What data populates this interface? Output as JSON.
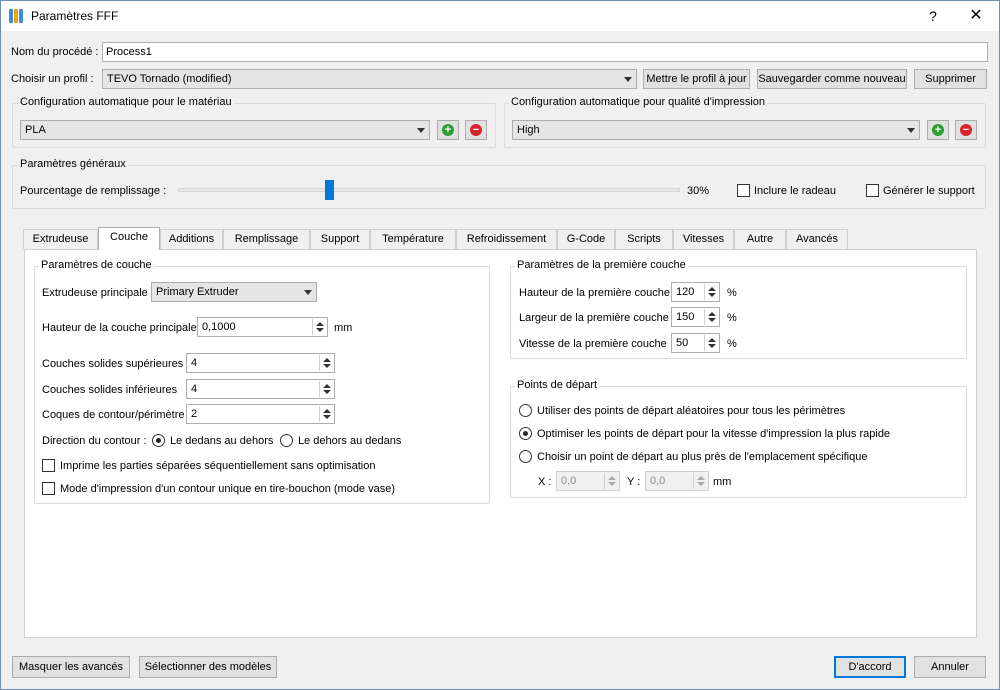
{
  "window": {
    "title": "Paramètres FFF",
    "help": "?",
    "close": "✕"
  },
  "process": {
    "label": "Nom du procédé :",
    "value": "Process1"
  },
  "profile": {
    "label": "Choisir un profil :",
    "selected": "TEVO Tornado (modified)",
    "update_btn": "Mettre le profil à jour",
    "save_new_btn": "Sauvegarder comme nouveau",
    "delete_btn": "Supprimer"
  },
  "auto_material": {
    "title": "Configuration automatique pour le matériau",
    "selected": "PLA"
  },
  "auto_quality": {
    "title": "Configuration automatique pour qualité d'impression",
    "selected": "High"
  },
  "general": {
    "title": "Paramètres généraux",
    "infill_label": "Pourcentage de remplissage :",
    "infill_percent": 30,
    "infill_value": "30%",
    "raft_label": "Inclure le radeau",
    "support_label": "Générer le support"
  },
  "tabs": [
    "Extrudeuse",
    "Couche",
    "Additions",
    "Remplissage",
    "Support",
    "Température",
    "Refroidissement",
    "G-Code",
    "Scripts",
    "Vitesses",
    "Autre",
    "Avancés"
  ],
  "layer": {
    "title": "Paramètres de couche",
    "extruder_label": "Extrudeuse principale",
    "extruder_value": "Primary Extruder",
    "height_label": "Hauteur de la couche principale",
    "height_value": "0,1000",
    "height_unit": "mm",
    "top_label": "Couches solides supérieures",
    "top_value": "4",
    "bottom_label": "Couches solides inférieures",
    "bottom_value": "4",
    "perimeter_label": "Coques de contour/périmètre",
    "perimeter_value": "2",
    "direction_label": "Direction du contour :",
    "direction_inside": "Le dedans au dehors",
    "direction_outside": "Le dehors au dedans",
    "sequential_label": "Imprime les parties séparées séquentiellement sans optimisation",
    "vase_label": "Mode d'impression d'un contour unique en tire-bouchon (mode vase)"
  },
  "first_layer": {
    "title": "Paramètres de la première couche",
    "height_label": "Hauteur de la première couche",
    "height_value": "120",
    "width_label": "Largeur de la première couche",
    "width_value": "150",
    "speed_label": "Vitesse de la première couche",
    "speed_value": "50",
    "unit": "%"
  },
  "start_points": {
    "title": "Points de départ",
    "opt_random": "Utiliser des points de départ aléatoires pour tous les périmètres",
    "opt_optimize": "Optimiser les points de départ pour la vitesse d'impression la plus rapide",
    "opt_specific": "Choisir un point de départ au plus près de l'emplacement spécifique",
    "x_label": "X :",
    "x_value": "0,0",
    "y_label": "Y :",
    "y_value": "0,0",
    "unit": "mm"
  },
  "footer": {
    "hide_advanced": "Masquer les avancés",
    "select_models": "Sélectionner des modèles",
    "ok": "D'accord",
    "cancel": "Annuler"
  },
  "colors": {
    "accent": "#0078d7",
    "add": "#2e9e34",
    "remove": "#d8242b"
  }
}
